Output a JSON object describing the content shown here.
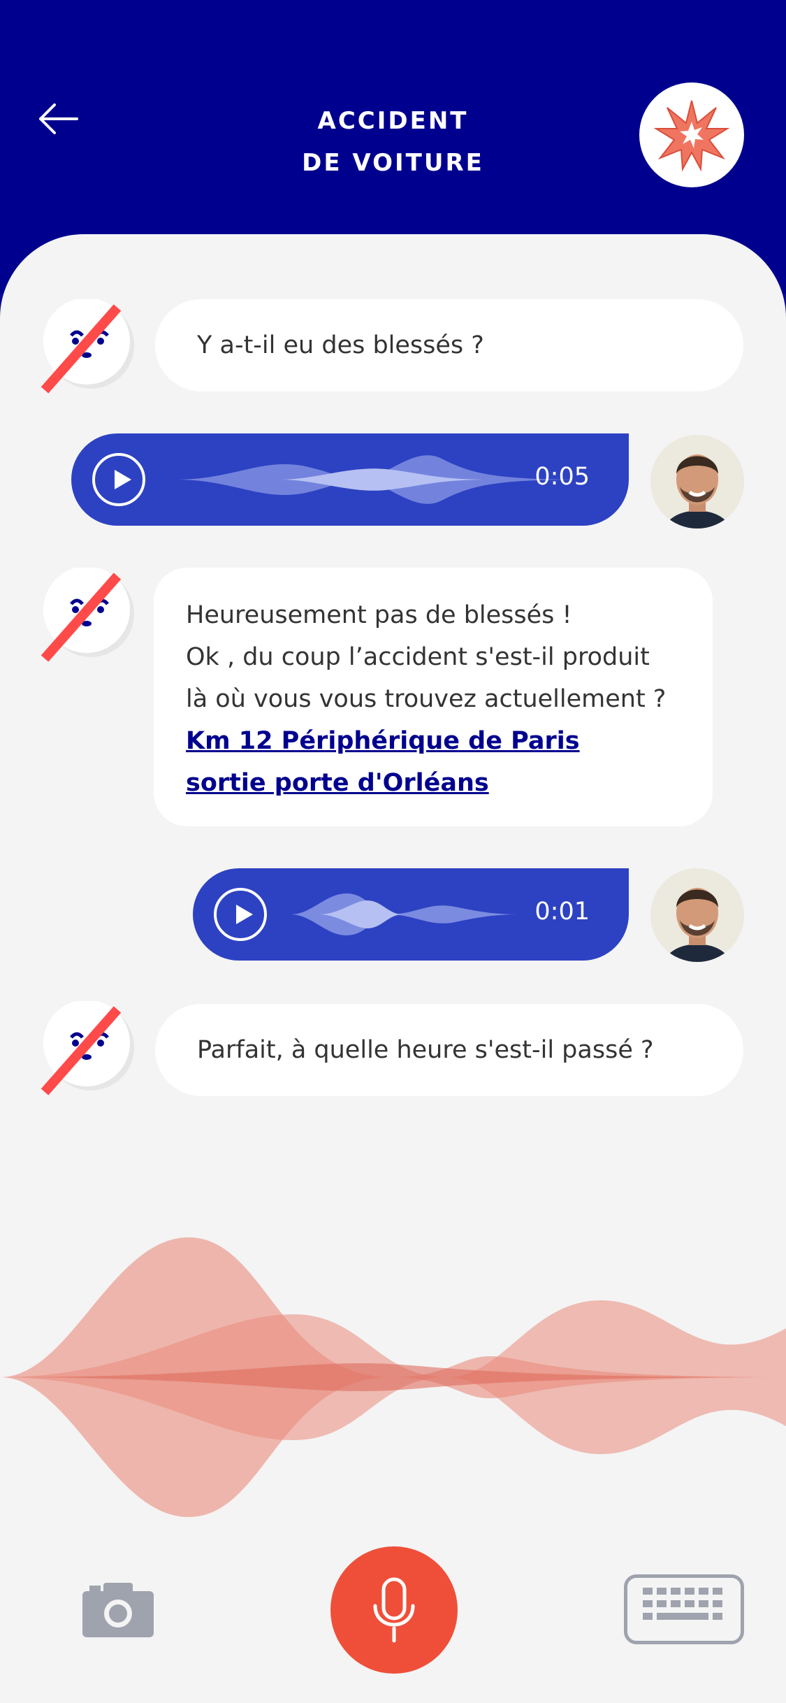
{
  "header": {
    "title_line1": "ACCIDENT",
    "title_line2": "DE VOITURE",
    "back_icon": "arrow-left-icon",
    "badge_icon": "explosion-star-icon"
  },
  "messages": [
    {
      "from": "bot",
      "text": "Y a-t-il eu des blessés ?"
    },
    {
      "from": "user",
      "type": "audio",
      "duration": "0:05"
    },
    {
      "from": "bot",
      "lines": [
        "Heureusement pas de blessés !",
        "Ok , du coup l’accident s'est-il produit",
        "là où vous vous trouvez actuellement ?"
      ],
      "link_lines": [
        "Km 12 Périphérique de Paris",
        "sortie porte d'Orléans"
      ]
    },
    {
      "from": "user",
      "type": "audio",
      "duration": "0:01"
    },
    {
      "from": "bot",
      "text": "Parfait, à quelle heure s'est-il passé ?"
    }
  ],
  "controls": {
    "camera_icon": "camera-icon",
    "mic_icon": "microphone-icon",
    "keyboard_icon": "keyboard-icon"
  },
  "colors": {
    "header_bg": "#00008f",
    "audio_bg": "#2d42c2",
    "accent_red": "#ef4f39",
    "sheet_bg": "#f4f4f4"
  }
}
